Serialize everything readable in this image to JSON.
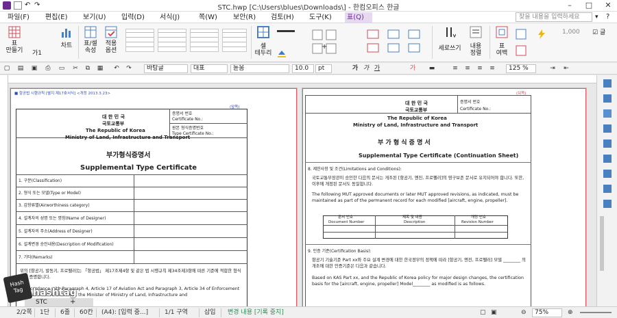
{
  "window": {
    "title": "STC.hwp [C:\\Users\\blues\\Downloads\\] - 한컴오피스 한글",
    "minimize": "–",
    "maximize": "□",
    "close": "✕"
  },
  "menu": {
    "items": [
      "파일(F)",
      "편집(E)",
      "보기(U)",
      "입력(D)",
      "서식(J)",
      "쪽(W)",
      "보안(R)",
      "검토(H)",
      "도구(K)",
      "표(Q)"
    ],
    "active_index": 9,
    "search_placeholder": "찾을 내용을 입력하세요"
  },
  "ribbon": {
    "buttons": [
      {
        "label": "표\n만들기"
      },
      {
        "label": "가1"
      },
      {
        "label": "차트"
      },
      {
        "label": "표/셀\n속성"
      },
      {
        "label": "적용\n옵션"
      },
      {
        "label": "셀\n테두리"
      },
      {
        "label": "세로쓰기"
      },
      {
        "label": "내용\n정렬"
      },
      {
        "label": "표\n여백"
      },
      {
        "label": "1,000"
      },
      {
        "label": "글"
      }
    ]
  },
  "format": {
    "style": "바탕글",
    "lang": "대표",
    "font": "돋움",
    "size": "10.0",
    "unit": "pt",
    "bold": "가",
    "italic": "가",
    "underline": "가",
    "zoom_pct": "125",
    "zoom_unit": "%"
  },
  "doc_left": {
    "header_note": "■ 항공법 시행규칙 [별지 제17호서식] <개정 2013.3.23>",
    "side_label": "(앞쪽)",
    "agency_ko_1": "대 한 민 국",
    "agency_ko_2": "국토교통부",
    "agency_en_1": "The Republic of Korea",
    "agency_en_2": "Ministry of Land, Infrastructure and Transport",
    "cert_no_ko": "증명서 번호",
    "cert_no_en": "Certificate No.:",
    "tc_no_ko": "원본 형식증명번호",
    "tc_no_en": "Type Certificate No.:",
    "title_ko": "부가형식증명서",
    "title_en": "Supplemental Type Certificate",
    "rows": [
      "1. 구분(Classification)",
      "2. 형식 또는 모델(Type or Model)",
      "3. 감항류별(Airworthiness category)",
      "4. 설계자의 성명 또는 명칭(Name of Designer)",
      "5. 설계자의 주소(Address of Designer)",
      "6. 설계변경 승인내용(Description of Modification)",
      "7. 기타(Remarks)"
    ],
    "body_ko": "위의 [항공기, 발동기, 프로펠러]는 「항공법」 제17조제4항 및 같은 법 시행규칙 제34조제3항에 따른 기준에 적합한 형식임을 증명합니다.",
    "body_en": "In accordance with Paragraph 4, Article 17 of Aviation Act and Paragraph 3, Article 34 of Enforcement Regulation of Aviation Act, the Minister of Ministry of Land, Infrastructure and"
  },
  "doc_right": {
    "side_label": "(뒤쪽)",
    "agency_ko_1": "대 한 민 국",
    "agency_ko_2": "국토교통부",
    "agency_en_1": "The Republic of Korea",
    "agency_en_2": "Ministry of Land, Infrastructure and Transport",
    "cert_no_ko": "증명서 번호",
    "cert_no_en": "Certificate No.:",
    "title_ko": "부 가 형 식 증 명 서",
    "title_en": "Supplemental Type Certificate (Continuation Sheet)",
    "sec8": "8. 제한사항 및 조건(Limitations and Conditions):",
    "sec8_ko": "국토교통부장관이 승인한 다음의 문서는 개조된 [항공기, 엔진, 프로펠러]의 영구보존 문서로 유지되어야 합니다. 또한, 이후에 개정된 문서도 동일합니다.",
    "sec8_en": "The following MUT approved documents or later MUT approved revisions, as indicated, must be maintained as part of the permanent record for each modified [aircraft, engine, propeller].",
    "doc_table_headers": [
      [
        "문서 번호",
        "Document Number"
      ],
      [
        "제목 및 내용",
        "Description"
      ],
      [
        "개정 번호",
        "Revision Number"
      ]
    ],
    "sec9": "9. 인증 기준(Certification Basis):",
    "sec9_ko": "항공기 기술기준 Part xx와 주요 설계 변경에 대한 한국정부의 정책에 따라 [항공기, 엔진, 프로펠러] 모델 ________ 의 개조에 대한 인증기준은 다음과 같습니다.",
    "sec9_en": "Based on KAS Part xx, and the Republic of Korea policy for major design changes, the certification basis for the [aircraft, engine, propeller] Model________ as modified is as follows."
  },
  "tab": {
    "name": "STC",
    "add": "+"
  },
  "status": {
    "page": "2/2쪽",
    "section": "1단",
    "line": "6줄",
    "col": "60칸",
    "paper": "(A4): [입력 중...]",
    "area": "1/1 구역",
    "mode": "삽입",
    "track": "변경 내용 [기록 중지]",
    "zoom": "75%"
  },
  "watermark": {
    "text": "hashtag",
    "badge": "Hash\nTag"
  },
  "colors": {
    "accent_purple": "#8b3fb5",
    "active_menu_bg": "#e8d9f2",
    "page_frame": "#e05a6a",
    "status_green": "#2e8b57"
  }
}
